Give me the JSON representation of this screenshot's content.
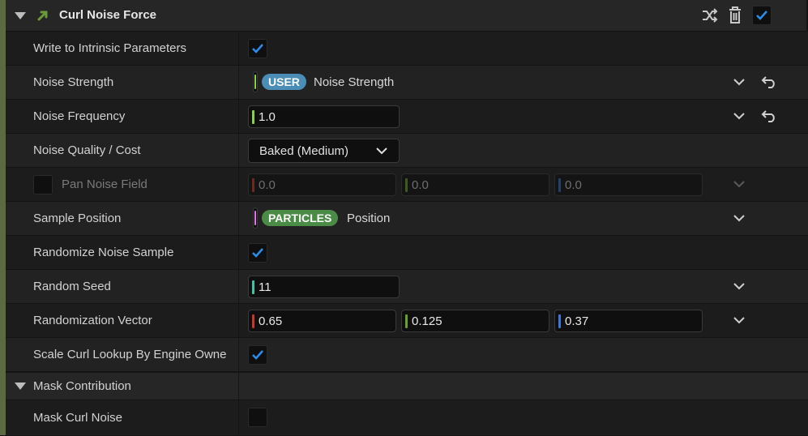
{
  "module": {
    "title": "Curl Noise Force",
    "enabled": true
  },
  "colors": {
    "accent_bar": "#5c6b3f",
    "check_blue": "#2b8ce8",
    "user_pill": "#4a8db6",
    "particles_pill": "#4a8c45",
    "stripe_green": "#8bd33b",
    "stripe_pink": "#e274e8",
    "stripe_teal": "#35c7a2",
    "stripe_red": "#c8382a",
    "stripe_lime": "#6aa02c",
    "stripe_blue": "#3a78d8"
  },
  "rows": {
    "write_intrinsic": {
      "label": "Write to Intrinsic Parameters",
      "checked": true
    },
    "noise_strength": {
      "label": "Noise Strength",
      "namespace": "USER",
      "binding": "Noise Strength"
    },
    "noise_frequency": {
      "label": "Noise Frequency",
      "value": "1.0"
    },
    "noise_quality": {
      "label": "Noise Quality / Cost",
      "selected": "Baked (Medium)"
    },
    "pan_noise_field": {
      "label": "Pan Noise Field",
      "enabled": false,
      "x": "0.0",
      "y": "0.0",
      "z": "0.0"
    },
    "sample_position": {
      "label": "Sample Position",
      "namespace": "PARTICLES",
      "binding": "Position"
    },
    "randomize_noise": {
      "label": "Randomize Noise Sample",
      "checked": true
    },
    "random_seed": {
      "label": "Random Seed",
      "value": "11"
    },
    "randomization_vector": {
      "label": "Randomization Vector",
      "x": "0.65",
      "y": "0.125",
      "z": "0.37"
    },
    "scale_curl": {
      "label": "Scale Curl Lookup By Engine Owne",
      "checked": true
    }
  },
  "mask_section": {
    "label": "Mask Contribution",
    "mask_curl_noise": {
      "label": "Mask Curl Noise",
      "checked": false
    }
  }
}
